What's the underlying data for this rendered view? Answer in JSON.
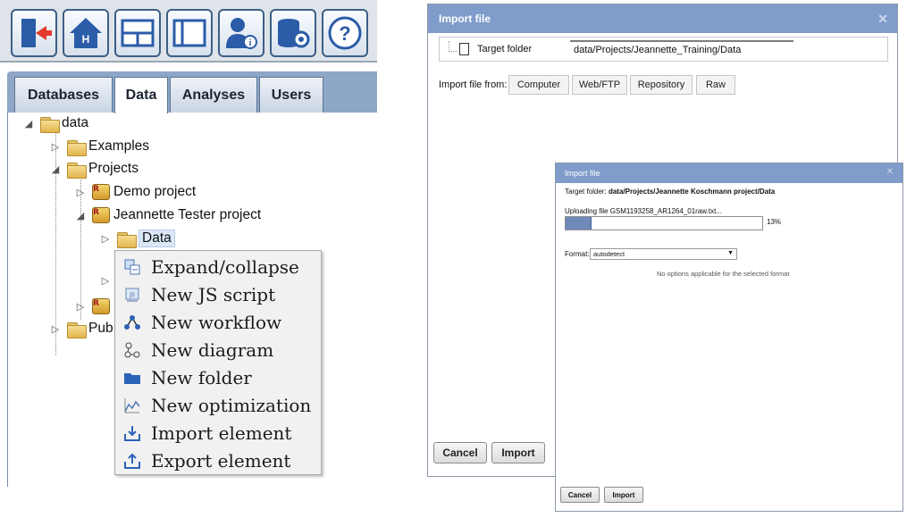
{
  "left": {
    "toolbar": {
      "icons": [
        "exit-icon",
        "home-icon",
        "layout-icon",
        "window-icon",
        "user-info-icon",
        "database-settings-icon",
        "help-icon"
      ]
    },
    "tabs": [
      {
        "label": "Databases"
      },
      {
        "label": "Data"
      },
      {
        "label": "Analyses"
      },
      {
        "label": "Users"
      }
    ],
    "active_tab": "Data",
    "tree": {
      "root": "data",
      "examples": "Examples",
      "projects": "Projects",
      "demo_project": "Demo project",
      "jeannette_project": "Jeannette Tester project",
      "data_folder": "Data",
      "pub_truncated": "Pub"
    },
    "context_menu": [
      {
        "label": "Expand/collapse",
        "icon": "expand-collapse-icon"
      },
      {
        "label": "New JS script",
        "icon": "js-script-icon"
      },
      {
        "label": "New workflow",
        "icon": "workflow-icon"
      },
      {
        "label": "New diagram",
        "icon": "diagram-icon"
      },
      {
        "label": "New folder",
        "icon": "folder-icon"
      },
      {
        "label": "New optimization",
        "icon": "optimization-icon"
      },
      {
        "label": "Import element",
        "icon": "import-icon"
      },
      {
        "label": "Export element",
        "icon": "export-icon"
      }
    ]
  },
  "dialog_main": {
    "title": "Import file",
    "target_folder_label": "Target folder",
    "target_folder_value": "data/Projects/Jeannette_Training/Data",
    "import_from_label": "Import file from:",
    "sources": [
      "Computer",
      "Web/FTP",
      "Repository",
      "Raw"
    ],
    "cancel_label": "Cancel",
    "import_label": "Import"
  },
  "dialog_upload": {
    "title": "Import file",
    "target_folder_label": "Target folder:",
    "target_folder_value": "data/Projects/Jeannette Koschmann project/Data",
    "uploading_label": "Uploading file GSM1193258_AR1264_01raw.txt...",
    "progress_percent": 13,
    "progress_text": "13%",
    "format_label": "Format:",
    "format_value": "autodetect",
    "no_options_text": "No options applicable for the selected format",
    "cancel_label": "Cancel",
    "import_label": "Import"
  },
  "colors": {
    "title_bar": "#7f9ccb",
    "progress_fill": "#6f89b9",
    "tab_bar": "#8fa7c6"
  }
}
